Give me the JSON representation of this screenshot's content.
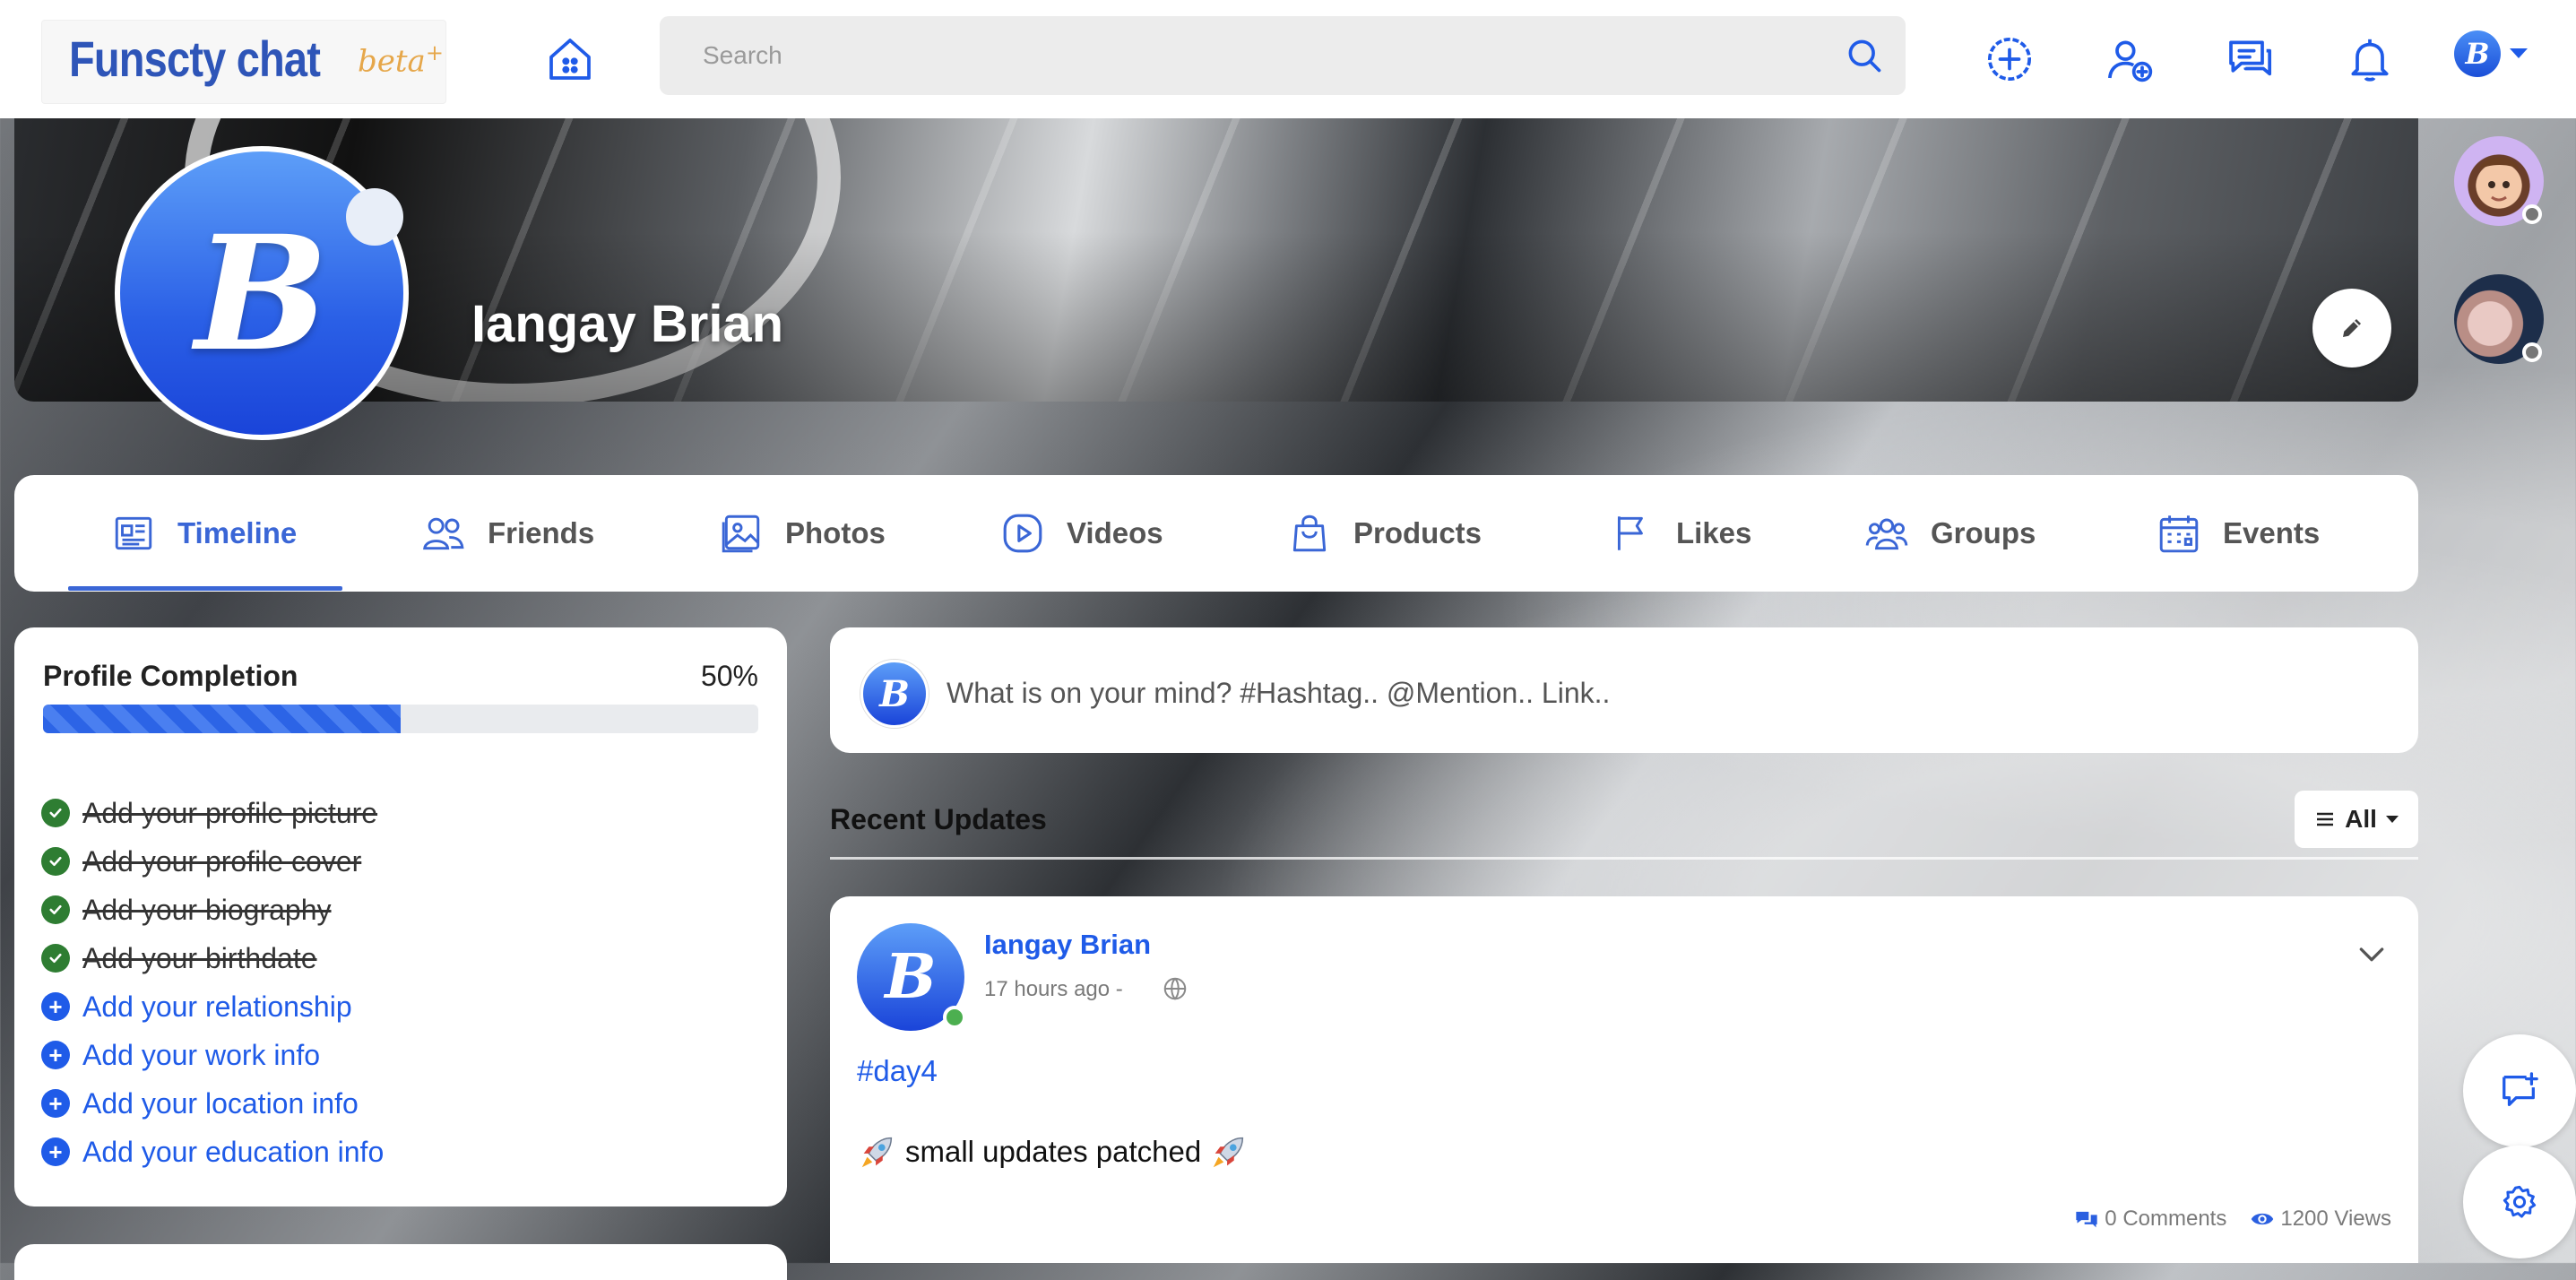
{
  "brand": {
    "name": "Funscty chat",
    "tag": "beta",
    "tag_plus": "+"
  },
  "search": {
    "placeholder": "Search"
  },
  "topbar_icons": [
    "home-icon",
    "create-icon",
    "add-friend-icon",
    "messages-icon",
    "notifications-icon"
  ],
  "user_menu": {
    "avatar_letter": "B"
  },
  "profile": {
    "name": "Iangay Brian",
    "avatar_letter": "B"
  },
  "tabs": [
    {
      "label": "Timeline",
      "icon": "newspaper-icon",
      "active": true
    },
    {
      "label": "Friends",
      "icon": "users-icon"
    },
    {
      "label": "Photos",
      "icon": "image-icon"
    },
    {
      "label": "Videos",
      "icon": "play-icon"
    },
    {
      "label": "Products",
      "icon": "shopping-bag-icon"
    },
    {
      "label": "Likes",
      "icon": "flag-icon"
    },
    {
      "label": "Groups",
      "icon": "group-icon"
    },
    {
      "label": "Events",
      "icon": "calendar-icon"
    }
  ],
  "profile_completion": {
    "title": "Profile Completion",
    "percent_label": "50%",
    "percent": 50,
    "items": [
      {
        "label": "Add your profile picture",
        "done": true
      },
      {
        "label": "Add your profile cover",
        "done": true
      },
      {
        "label": "Add your biography",
        "done": true
      },
      {
        "label": "Add your birthdate",
        "done": true
      },
      {
        "label": "Add your relationship",
        "done": false
      },
      {
        "label": "Add your work info",
        "done": false
      },
      {
        "label": "Add your location info",
        "done": false
      },
      {
        "label": "Add your education info",
        "done": false
      }
    ]
  },
  "composer": {
    "placeholder": "What is on your mind? #Hashtag.. @Mention.. Link.."
  },
  "feed": {
    "title": "Recent Updates",
    "filter_label": "All"
  },
  "post": {
    "author": "Iangay Brian",
    "time": "17 hours ago -",
    "hashtag": "#day4",
    "text": "small updates patched",
    "comments": "0 Comments",
    "views": "1200 Views"
  },
  "colors": {
    "accent": "#1f5be8",
    "brand": "#2e55b8",
    "beta": "#e6a74a",
    "online": "#4caf50",
    "done": "#2e7d32"
  }
}
